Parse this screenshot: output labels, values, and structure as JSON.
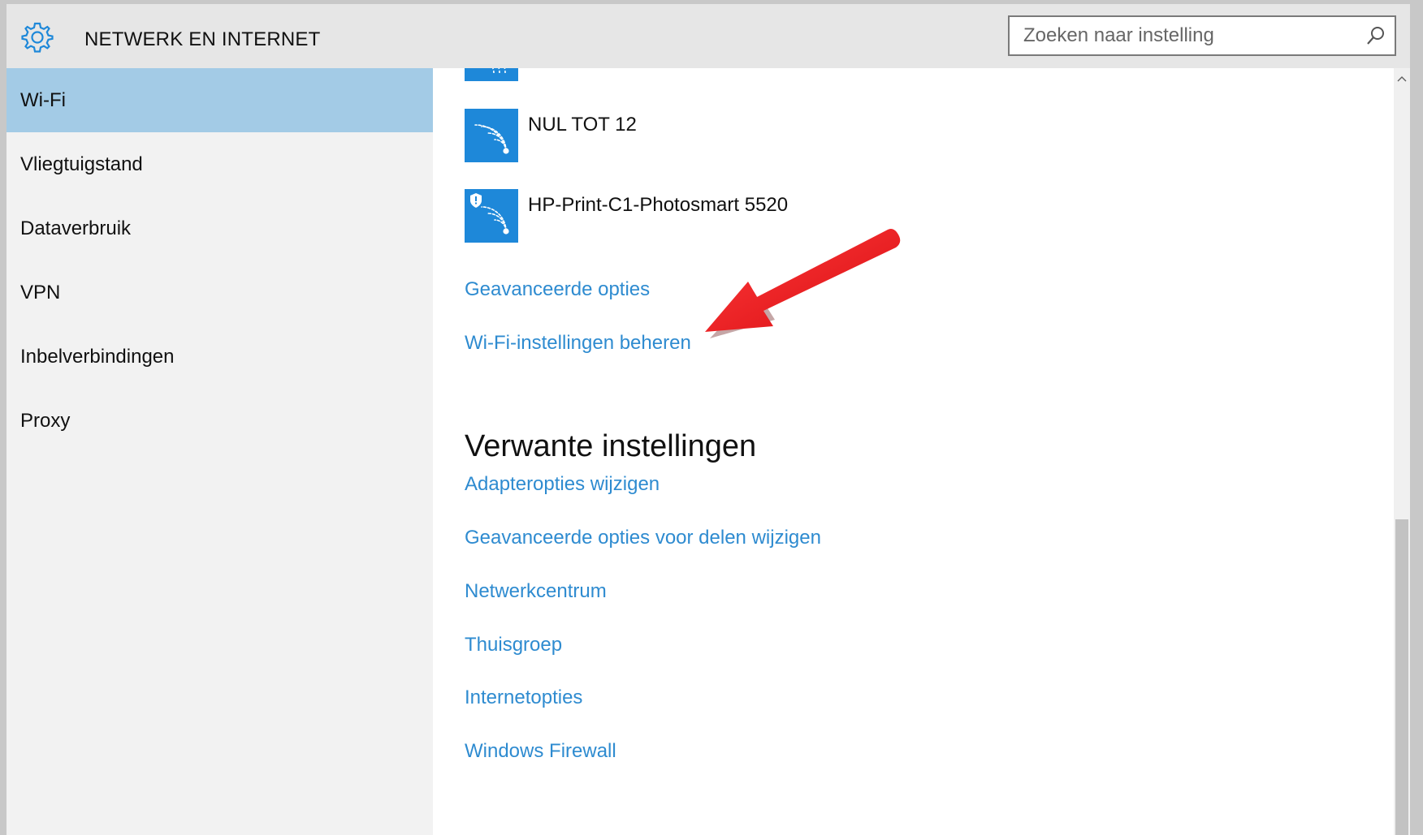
{
  "header": {
    "title": "NETWERK EN INTERNET",
    "icon": "gear-icon",
    "search_placeholder": "Zoeken naar instelling"
  },
  "sidebar": {
    "items": [
      {
        "label": "Wi-Fi",
        "active": true
      },
      {
        "label": "Vliegtuigstand",
        "active": false
      },
      {
        "label": "Dataverbruik",
        "active": false
      },
      {
        "label": "VPN",
        "active": false
      },
      {
        "label": "Inbelverbindingen",
        "active": false
      },
      {
        "label": "Proxy",
        "active": false
      }
    ]
  },
  "networks": [
    {
      "name": "NUL TOT 12",
      "secured_badge": false
    },
    {
      "name": "HP-Print-C1-Photosmart 5520",
      "secured_badge": true
    }
  ],
  "links": {
    "advanced": "Geavanceerde opties",
    "manage_wifi": "Wi-Fi-instellingen beheren"
  },
  "related": {
    "title": "Verwante instellingen",
    "links": [
      "Adapteropties wijzigen",
      "Geavanceerde opties voor delen wijzigen",
      "Netwerkcentrum",
      "Thuisgroep",
      "Internetopties",
      "Windows Firewall"
    ]
  },
  "colors": {
    "accent": "#1e88d9",
    "link": "#2e8bd0",
    "sidebar_active": "#a3cbe6",
    "annotation_arrow": "#e8191d"
  }
}
